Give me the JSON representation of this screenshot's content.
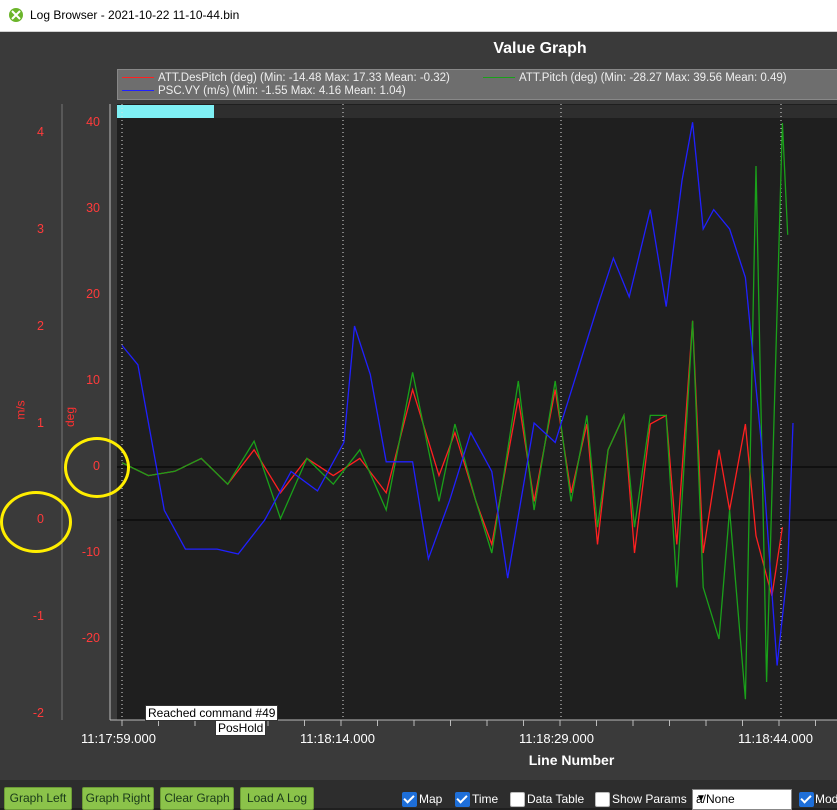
{
  "window": {
    "title": "Log Browser - 2021-10-22 11-10-44.bin",
    "icon": "app-logo-icon"
  },
  "graph": {
    "title": "Value Graph",
    "xaxis_title": "Line Number",
    "left_axis_unit": "m/s",
    "right_axis_unit": "deg",
    "left_ticks": [
      "4",
      "3",
      "2",
      "1",
      "0",
      "-1",
      "-2"
    ],
    "right_ticks": [
      "40",
      "30",
      "20",
      "10",
      "0",
      "-10",
      "-20"
    ],
    "x_ticks": [
      "11:17:59.000",
      "11:18:14.000",
      "11:18:29.000",
      "11:18:44.000"
    ],
    "legend": [
      {
        "label": "ATT.DesPitch (deg) (Min: -14.48 Max: 17.33 Mean: -0.32)",
        "color": "#ff2020"
      },
      {
        "label": "ATT.Pitch (deg) (Min: -28.27 Max: 39.56 Mean: 0.49)",
        "color": "#1aa01a"
      },
      {
        "label": "PSC.VY (m/s) (Min: -1.55 Max: 4.16 Mean: 1.04)",
        "color": "#2020ff"
      }
    ],
    "annotations": [
      "Reached command #49",
      "PosHold"
    ],
    "progress_fraction": 0.135
  },
  "chart_data": {
    "type": "line",
    "x_label": "Line Number",
    "y_left_label": "m/s",
    "y_right_label": "deg",
    "y_left_range": [
      -2,
      4
    ],
    "y_right_range": [
      -20,
      40
    ],
    "series": [
      {
        "name": "ATT.DesPitch (deg)",
        "color": "#ff2020",
        "points": [
          [
            0,
            0.5
          ],
          [
            0.05,
            -1
          ],
          [
            0.1,
            -0.5
          ],
          [
            0.15,
            1
          ],
          [
            0.2,
            -2
          ],
          [
            0.25,
            2
          ],
          [
            0.3,
            -3
          ],
          [
            0.35,
            1
          ],
          [
            0.4,
            -1
          ],
          [
            0.45,
            1
          ],
          [
            0.5,
            -3
          ],
          [
            0.55,
            9
          ],
          [
            0.6,
            -1
          ],
          [
            0.63,
            4
          ],
          [
            0.67,
            -4
          ],
          [
            0.7,
            -9
          ],
          [
            0.75,
            8
          ],
          [
            0.78,
            -4
          ],
          [
            0.82,
            9
          ],
          [
            0.85,
            -3
          ],
          [
            0.88,
            5
          ],
          [
            0.9,
            -9
          ],
          [
            0.92,
            2
          ],
          [
            0.95,
            6
          ],
          [
            0.97,
            -10
          ],
          [
            1.0,
            5
          ],
          [
            1.03,
            6
          ],
          [
            1.05,
            -9
          ],
          [
            1.08,
            17
          ],
          [
            1.1,
            -10
          ],
          [
            1.13,
            2
          ],
          [
            1.15,
            -5
          ],
          [
            1.18,
            5
          ],
          [
            1.2,
            -8
          ],
          [
            1.23,
            -15
          ],
          [
            1.25,
            -7
          ]
        ]
      },
      {
        "name": "ATT.Pitch (deg)",
        "color": "#1aa01a",
        "points": [
          [
            0,
            0.5
          ],
          [
            0.05,
            -1
          ],
          [
            0.1,
            -0.5
          ],
          [
            0.15,
            1
          ],
          [
            0.2,
            -2
          ],
          [
            0.25,
            3
          ],
          [
            0.3,
            -6
          ],
          [
            0.35,
            1
          ],
          [
            0.4,
            -2
          ],
          [
            0.45,
            2
          ],
          [
            0.5,
            -5
          ],
          [
            0.55,
            11
          ],
          [
            0.6,
            -4
          ],
          [
            0.63,
            5
          ],
          [
            0.67,
            -4
          ],
          [
            0.7,
            -10
          ],
          [
            0.75,
            10
          ],
          [
            0.78,
            -5
          ],
          [
            0.82,
            10
          ],
          [
            0.85,
            -4
          ],
          [
            0.88,
            6
          ],
          [
            0.9,
            -7
          ],
          [
            0.92,
            2
          ],
          [
            0.95,
            6
          ],
          [
            0.97,
            -7
          ],
          [
            1.0,
            6
          ],
          [
            1.03,
            6
          ],
          [
            1.05,
            -14
          ],
          [
            1.08,
            17
          ],
          [
            1.1,
            -14
          ],
          [
            1.13,
            -20
          ],
          [
            1.15,
            -5
          ],
          [
            1.18,
            -27
          ],
          [
            1.2,
            35
          ],
          [
            1.22,
            -25
          ],
          [
            1.25,
            40
          ],
          [
            1.26,
            27
          ]
        ]
      },
      {
        "name": "PSC.VY (m/s)",
        "color": "#2020ff",
        "points": [
          [
            0,
            1.8
          ],
          [
            0.03,
            1.6
          ],
          [
            0.08,
            0.1
          ],
          [
            0.12,
            -0.3
          ],
          [
            0.18,
            -0.3
          ],
          [
            0.22,
            -0.35
          ],
          [
            0.27,
            0.0
          ],
          [
            0.32,
            0.5
          ],
          [
            0.37,
            0.3
          ],
          [
            0.42,
            0.8
          ],
          [
            0.44,
            2.0
          ],
          [
            0.47,
            1.5
          ],
          [
            0.5,
            0.6
          ],
          [
            0.55,
            0.6
          ],
          [
            0.58,
            -0.4
          ],
          [
            0.62,
            0.2
          ],
          [
            0.66,
            0.9
          ],
          [
            0.7,
            0.5
          ],
          [
            0.73,
            -0.6
          ],
          [
            0.78,
            1.0
          ],
          [
            0.82,
            0.8
          ],
          [
            0.86,
            1.5
          ],
          [
            0.9,
            2.2
          ],
          [
            0.93,
            2.7
          ],
          [
            0.96,
            2.3
          ],
          [
            1.0,
            3.2
          ],
          [
            1.03,
            2.2
          ],
          [
            1.06,
            3.5
          ],
          [
            1.08,
            4.1
          ],
          [
            1.1,
            3.0
          ],
          [
            1.12,
            3.2
          ],
          [
            1.15,
            3.0
          ],
          [
            1.18,
            2.5
          ],
          [
            1.21,
            0.8
          ],
          [
            1.24,
            -1.5
          ],
          [
            1.26,
            -0.5
          ],
          [
            1.27,
            1.0
          ]
        ]
      }
    ]
  },
  "buttons": [
    "Graph Left",
    "Graph Right",
    "Clear Graph",
    "Load A Log"
  ],
  "checkboxes": [
    {
      "label": "Map",
      "checked": true
    },
    {
      "label": "Time",
      "checked": true
    },
    {
      "label": "Data Table",
      "checked": false
    },
    {
      "label": "Show Params",
      "checked": false
    }
  ],
  "select": {
    "value": "a/None"
  },
  "mode_checkbox": {
    "label": "Mod",
    "checked": true
  }
}
